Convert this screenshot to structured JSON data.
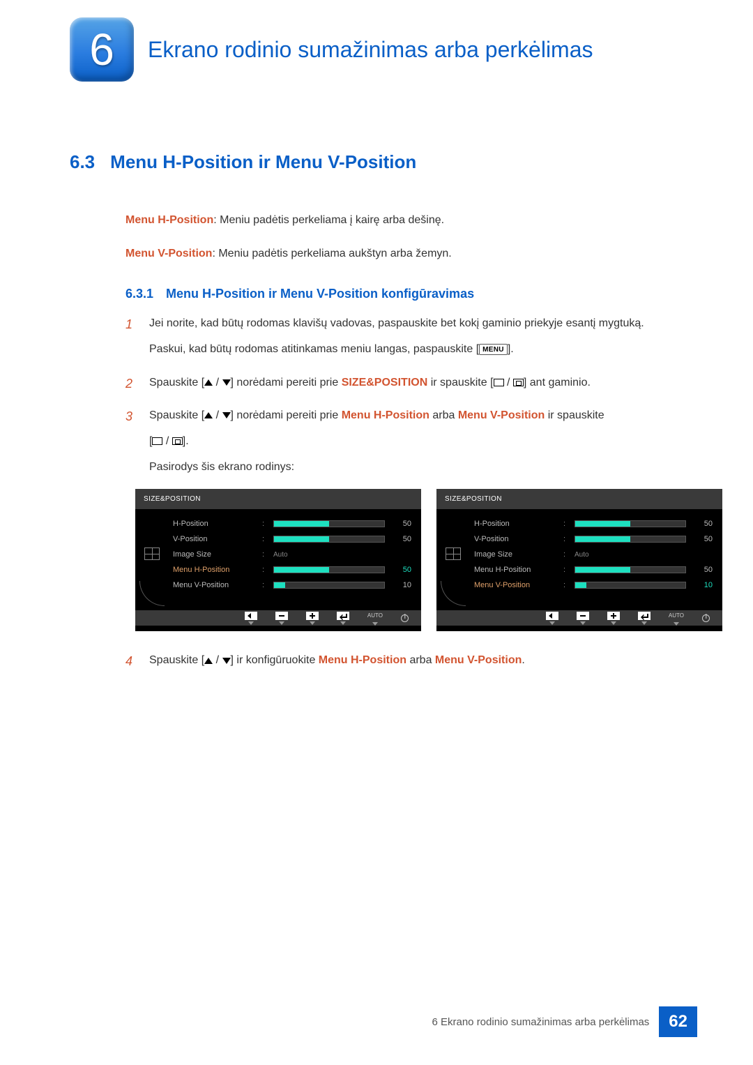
{
  "chapter": {
    "number": "6",
    "title": "Ekrano rodinio sumažinimas arba perkėlimas"
  },
  "section": {
    "number": "6.3",
    "title": "Menu H-Position ir Menu V-Position"
  },
  "intro": {
    "h_label": "Menu H-Position",
    "h_desc": ": Meniu padėtis perkeliama į kairę arba dešinę.",
    "v_label": "Menu V-Position",
    "v_desc": ": Meniu padėtis perkeliama aukštyn arba žemyn."
  },
  "subsection": {
    "number": "6.3.1",
    "title": "Menu H-Position ir Menu V-Position konfigūravimas"
  },
  "steps": {
    "s1a": "Jei norite, kad būtų rodomas klavišų vadovas, paspauskite bet kokį gaminio priekyje esantį mygtuką.",
    "s1b_pre": "Paskui, kad būtų rodomas atitinkamas meniu langas, paspauskite [",
    "s1b_menu": "MENU",
    "s1b_post": "].",
    "s2_pre": "Spauskite [",
    "s2_mid1": "] norėdami pereiti prie ",
    "s2_size": "SIZE&POSITION",
    "s2_mid2": " ir spauskite [",
    "s2_post": "] ant gaminio.",
    "s3_pre": "Spauskite [",
    "s3_mid1": "] norėdami pereiti prie ",
    "s3_h": "Menu H-Position",
    "s3_or": " arba ",
    "s3_v": "Menu V-Position",
    "s3_mid2": " ir spauskite",
    "s3_bracket_open": "[",
    "s3_bracket_close": "].",
    "s3_after": "Pasirodys šis ekrano rodinys:",
    "s4_pre": "Spauskite [",
    "s4_mid": "] ir konfigūruokite ",
    "s4_h": "Menu H-Position",
    "s4_or": " arba ",
    "s4_v": "Menu V-Position",
    "s4_post": "."
  },
  "osd": {
    "title": "SIZE&POSITION",
    "rows": {
      "hpos": {
        "label": "H-Position",
        "val": "50",
        "fill": 50
      },
      "vpos": {
        "label": "V-Position",
        "val": "50",
        "fill": 50
      },
      "isize": {
        "label": "Image Size",
        "val": "Auto"
      },
      "mhpos": {
        "label": "Menu H-Position",
        "val": "50",
        "fill": 50
      },
      "mvpos": {
        "label": "Menu V-Position",
        "val": "10",
        "fill": 10
      }
    },
    "bottom_auto": "AUTO"
  },
  "footer": {
    "text": "6 Ekrano rodinio sumažinimas arba perkėlimas",
    "page": "62"
  }
}
